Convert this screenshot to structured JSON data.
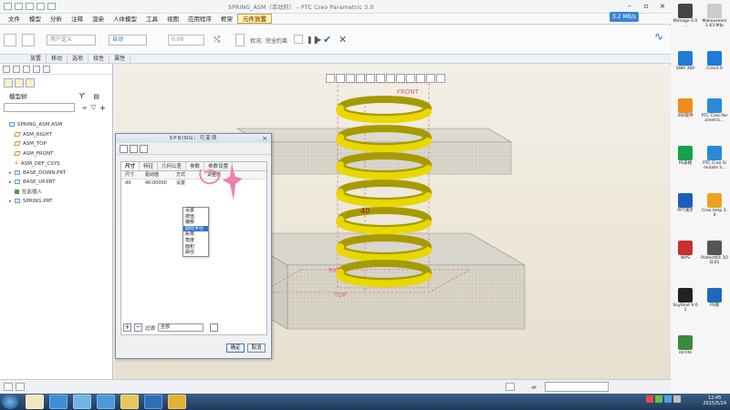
{
  "window": {
    "title": "SPRING_ASM（活动的） - PTC Creo Parametric 3.0",
    "net_speed": "3.2 MB/s"
  },
  "menu": [
    "文件",
    "模型",
    "分析",
    "注释",
    "渲染",
    "人体模型",
    "工具",
    "视图",
    "应用程序",
    "框架",
    "元件放置"
  ],
  "ribbon": {
    "combo1": "用户定义",
    "combo2": "自动",
    "value": "0.00",
    "status_label": "状况:",
    "status_value": "完全约束",
    "sub_tabs": [
      "放置",
      "移动",
      "选项",
      "挠性",
      "属性"
    ]
  },
  "left_panel": {
    "header": "模型树",
    "tree": [
      {
        "label": "SPRING_ASM.ASM",
        "icon": "assembly-icon"
      },
      {
        "label": "ASM_RIGHT",
        "icon": "datum-plane-icon"
      },
      {
        "label": "ASM_TOP",
        "icon": "datum-plane-icon"
      },
      {
        "label": "ASM_FRONT",
        "icon": "datum-plane-icon"
      },
      {
        "label": "ASM_DEF_CSYS",
        "icon": "csys-icon"
      },
      {
        "label": "BASE_DOWN.PRT",
        "icon": "part-icon"
      },
      {
        "label": "BASE_UP.PRT",
        "icon": "part-icon"
      },
      {
        "label": "在此插入",
        "icon": "insert-here-icon"
      },
      {
        "label": "SPRING.PRT",
        "icon": "part-icon"
      }
    ]
  },
  "viewport": {
    "labels": {
      "front": "FRONT",
      "right": "RIGHT",
      "top": "TOP",
      "dim": "40"
    },
    "colors": {
      "spring": "#e8d800",
      "spring_dark": "#a79a00",
      "datum": "#d04040"
    }
  },
  "dialog": {
    "title": "SPRING：可变项",
    "tabs": [
      "尺寸",
      "特征",
      "几何公差",
      "参数",
      "参数设置"
    ],
    "columns": [
      "尺寸",
      "驱动值",
      "方式",
      "调整值"
    ],
    "row": {
      "dim": "d9",
      "value": "40.00000",
      "method": "设置"
    },
    "dropdown": [
      "设置",
      "按值",
      "偏移",
      "圆柱半径",
      "距离",
      "角度",
      "面积",
      "曲径"
    ],
    "dropdown_selected": 3,
    "filter_label": "过滤",
    "filter_value": "全部",
    "ok": "确定",
    "cancel": "取消"
  },
  "desktop_icons": [
    {
      "label": "Mimage 0.0 ...",
      "color": "#444444"
    },
    {
      "label": "Makeuseem 1.63 Mfp",
      "color": "#cccccc"
    },
    {
      "label": "SWA 360",
      "color": "#1e7bd8"
    },
    {
      "label": "Creo3.0",
      "color": "#1e7bd8"
    },
    {
      "label": "360软件",
      "color": "#f08c1c"
    },
    {
      "label": "PTC Creo Parametric...",
      "color": "#2a8ad8"
    },
    {
      "label": "PS表格",
      "color": "#16a04a"
    },
    {
      "label": "PTC Creo Simulate 3...",
      "color": "#2a8ad8"
    },
    {
      "label": "PPT演示",
      "color": "#1d5fb8"
    },
    {
      "label": "Creo Help 3.0",
      "color": "#f0a020"
    },
    {
      "label": "WPS",
      "color": "#c83030"
    },
    {
      "label": "ProtectKit 1OD.ES",
      "color": "#555555"
    },
    {
      "label": "SnyShot 9.01",
      "color": "#222222"
    },
    {
      "label": "PS图",
      "color": "#1e6ab8"
    },
    {
      "label": "ed-lite",
      "color": "#3c8a3c"
    }
  ],
  "taskbar": {
    "time": "12:45",
    "date": "2015/5/24"
  }
}
